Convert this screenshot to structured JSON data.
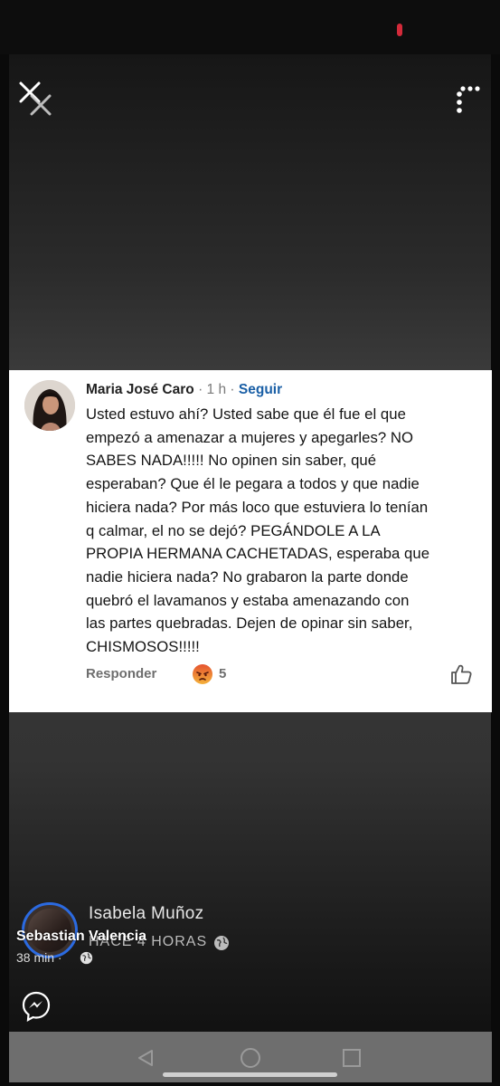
{
  "comment": {
    "author": "Maria José Caro",
    "separator": "·",
    "time": "1 h",
    "follow_label": "Seguir",
    "lines": [
      "Usted estuvo ahí? Usted sabe que él fue el que",
      "empezó a amenazar a mujeres y apegarles? NO",
      "SABES NADA!!!!! No opinen sin saber, qué",
      "esperaban? Que él le pegara a todos y que nadie",
      "hiciera nada? Por más loco que estuviera lo tenían",
      "q calmar, el no se dejó? PEGÁNDOLE A LA",
      "PROPIA HERMANA CACHETADAS, esperaba que",
      "nadie hiciera nada? No grabaron la parte donde",
      "quebró el lavamanos y estaba amenazando con",
      "las partes quebradas. Dejen de opinar sin saber,",
      "CHISMOSOS!!!!!"
    ],
    "reply_label": "Responder",
    "reaction_icon": "angry-face",
    "reaction_count": "5",
    "like_icon": "thumbs-up"
  },
  "story": {
    "poster_name": "Isabela Muñoz",
    "poster_time": "HACE 4 HORAS",
    "sharer_name": "Sebastian Valencia",
    "sharer_time": "38 min",
    "sharer_separator": "·"
  },
  "colors": {
    "accent_blue": "#1a5fa6",
    "ring_blue": "#2b6ae0",
    "angry_red": "#e5532f",
    "record_red": "#d32a3a"
  }
}
